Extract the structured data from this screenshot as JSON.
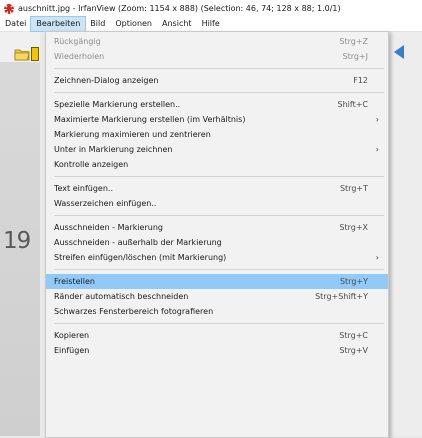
{
  "window": {
    "title": "auschnitt.jpg - IrfanView (Zoom: 1154 x 888) (Selection: 46, 74; 128 x 88; 1.0/1)"
  },
  "menubar": {
    "items": [
      "Datei",
      "Bearbeiten",
      "Bild",
      "Optionen",
      "Ansicht",
      "Hilfe"
    ],
    "active_index": 1
  },
  "canvas": {
    "text": "19"
  },
  "icons": {
    "app": "irfanview-red-cat-icon",
    "open_folder": "open-folder-icon",
    "right_toolbar": "blue-arrow-icon"
  },
  "menu": {
    "groups": [
      [
        {
          "label": "Rückgängig",
          "shortcut": "Strg+Z",
          "disabled": true
        },
        {
          "label": "Wiederholen",
          "shortcut": "Strg+J",
          "disabled": true
        }
      ],
      [
        {
          "label": "Zeichnen-Dialog anzeigen",
          "shortcut": "F12"
        }
      ],
      [
        {
          "label": "Spezielle Markierung erstellen..",
          "shortcut": "Shift+C"
        },
        {
          "label": "Maximierte Markierung erstellen (im Verhältnis)",
          "submenu": true
        },
        {
          "label": "Markierung maximieren und zentrieren"
        },
        {
          "label": "Unter in Markierung zeichnen",
          "submenu": true
        },
        {
          "label": "Kontrolle anzeigen"
        }
      ],
      [
        {
          "label": "Text einfügen..",
          "shortcut": "Strg+T"
        },
        {
          "label": "Wasserzeichen einfügen.."
        }
      ],
      [
        {
          "label": "Ausschneiden - Markierung",
          "shortcut": "Strg+X"
        },
        {
          "label": "Ausschneiden - außerhalb der Markierung"
        },
        {
          "label": "Streifen einfügen/löschen (mit Markierung)",
          "submenu": true
        }
      ],
      [
        {
          "label": "Freistellen",
          "shortcut": "Strg+Y",
          "highlighted": true
        },
        {
          "label": "Ränder automatisch beschneiden",
          "shortcut": "Strg+Shift+Y"
        },
        {
          "label": "Schwarzes Fensterbereich fotografieren"
        }
      ],
      [
        {
          "label": "Kopieren",
          "shortcut": "Strg+C"
        },
        {
          "label": "Einfügen",
          "shortcut": "Strg+V"
        }
      ]
    ]
  },
  "colors": {
    "highlight": "#91c9f7",
    "menu_bg": "#f2f2f2",
    "active_menubar": "#cce4f7"
  }
}
